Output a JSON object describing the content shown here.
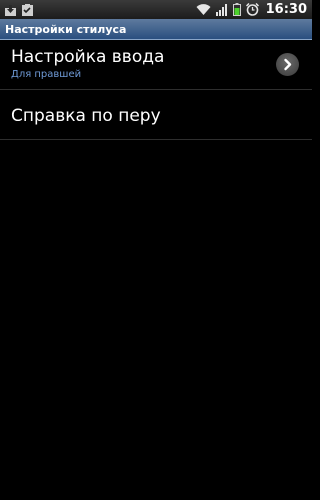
{
  "status_bar": {
    "time": "16:30",
    "icons": [
      "download-icon",
      "clipboard-check-icon",
      "wifi-icon",
      "signal-icon",
      "battery-icon",
      "alarm-icon"
    ],
    "battery_color": "#4cd12c"
  },
  "title_bar": {
    "title": "Настройки стилуса"
  },
  "list": {
    "items": [
      {
        "title": "Настройка ввода",
        "subtitle": "Для правшей",
        "icon": "chevron-right-icon"
      },
      {
        "title": "Справка по перу"
      }
    ]
  },
  "colors": {
    "background": "#000000",
    "subtitle": "#6f9ad6",
    "title_bar": "#2a4f7f"
  }
}
